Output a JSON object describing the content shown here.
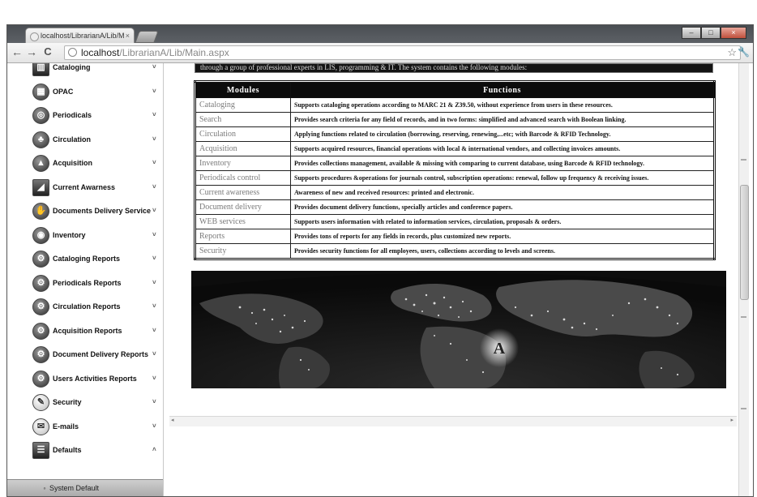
{
  "browser": {
    "tab_title": "localhost/LibrarianA/Lib/M",
    "tab_close": "×",
    "url_host": "localhost",
    "url_path": "/LibrarianA/Lib/Main.aspx",
    "back": "←",
    "forward": "→",
    "reload": "C",
    "star": "☆",
    "wrench": "🔧"
  },
  "sidebar": {
    "items": [
      {
        "label": "Cataloging",
        "icon": "books-icon",
        "glyph": "▥"
      },
      {
        "label": "OPAC",
        "icon": "opac-icon",
        "glyph": "▦"
      },
      {
        "label": "Periodicals",
        "icon": "periodicals-icon",
        "glyph": "◎"
      },
      {
        "label": "Circulation",
        "icon": "circulation-icon",
        "glyph": "♣"
      },
      {
        "label": "Acquisition",
        "icon": "acquisition-icon",
        "glyph": "▲"
      },
      {
        "label": "Current Awarness",
        "icon": "awareness-icon",
        "glyph": "◢"
      },
      {
        "label": "Documents Delivery Service",
        "icon": "delivery-icon",
        "glyph": "✋"
      },
      {
        "label": "Inventory",
        "icon": "inventory-icon",
        "glyph": "◉"
      },
      {
        "label": "Cataloging Reports",
        "icon": "report-icon",
        "glyph": "⚙"
      },
      {
        "label": "Periodicals Reports",
        "icon": "report-icon",
        "glyph": "⚙"
      },
      {
        "label": "Circulation Reports",
        "icon": "report-icon",
        "glyph": "⚙"
      },
      {
        "label": "Acquisition Reports",
        "icon": "report-icon",
        "glyph": "⚙"
      },
      {
        "label": "Document Delivery Reports",
        "icon": "report-icon",
        "glyph": "⚙"
      },
      {
        "label": "Users Activities Reports",
        "icon": "report-icon",
        "glyph": "⚙"
      },
      {
        "label": "Security",
        "icon": "security-icon",
        "glyph": "✎"
      },
      {
        "label": "E-mails",
        "icon": "envelope-icon",
        "glyph": "✉"
      },
      {
        "label": "Defaults",
        "icon": "defaults-icon",
        "glyph": "☰"
      }
    ],
    "chevron_down": "˅",
    "chevron_up": "˄",
    "sub_item": "System Default",
    "sub_bullet": "◦"
  },
  "content": {
    "intro_text": "through a group of professional experts in LIS, programming & IT. The system contains the following modules:",
    "table": {
      "headers": [
        "Modules",
        "Functions"
      ],
      "rows": [
        {
          "module": "Cataloging",
          "function": "Supports cataloging operations according to MARC 21 & Z39.50, without experience from users in these resources."
        },
        {
          "module": "Search",
          "function": "Provides search criteria for any field of records, and in two forms: simplified and advanced search with Boolean linking."
        },
        {
          "module": "Circulation",
          "function": "Applying functions related to circulation (borrowing, reserving, renewing,...etc; with Barcode & RFID Technology."
        },
        {
          "module": "Acquisition",
          "function": "Supports acquired resources, financial operations with local & international vendors, and collecting invoices amounts."
        },
        {
          "module": "Inventory",
          "function": "Provides collections management, available & missing with comparing to current database, using Barcode & RFID technology."
        },
        {
          "module": "Periodicals control",
          "function": "Supports procedures &operations for journals control, subscription operations: renewal, follow up frequency & receiving issues."
        },
        {
          "module": "Current awareness",
          "function": "Awareness of new and received resources: printed and electronic."
        },
        {
          "module": "Document delivery",
          "function": "Provides document delivery functions, specially articles and conference papers."
        },
        {
          "module": "WEB services",
          "function": "Supports users information with related to information services, circulation, proposals & orders."
        },
        {
          "module": "Reports",
          "function": "Provides tons of reports for any fields in records, plus customized new reports."
        },
        {
          "module": "Security",
          "function": "Provides security functions for all employees, users, collections according to levels and screens."
        }
      ]
    },
    "banner_logo": "A"
  },
  "scroll": {
    "left_arrow": "◂",
    "right_arrow": "▸"
  }
}
